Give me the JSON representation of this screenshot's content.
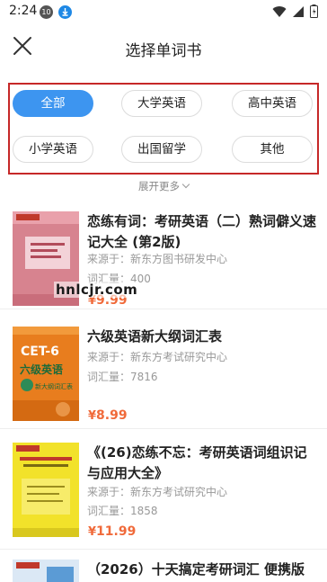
{
  "status_bar": {
    "time": "2:24",
    "notification_badge": "10"
  },
  "header": {
    "title": "选择单词书"
  },
  "filters": {
    "items": [
      "全部",
      "大学英语",
      "高中英语",
      "小学英语",
      "出国留学",
      "其他"
    ],
    "active": "全部",
    "accent": "#3d95f0",
    "highlight_border": "#c62828"
  },
  "expand_label": "展开更多",
  "books": [
    {
      "title": "恋练有词：考研英语（二）熟词僻义速记大全 (第2版)",
      "source_label": "来源于：",
      "source": "新东方图书研发中心",
      "count_label": "词汇量：",
      "count": "400",
      "price_symbol": "¥",
      "price": "9.99",
      "cover_text": "考研英语(二)熟词僻义速记大全"
    },
    {
      "title": "六级英语新大纲词汇表",
      "source_label": "来源于：",
      "source": "新东方考试研究中心",
      "count_label": "词汇量：",
      "count": "7816",
      "price_symbol": "¥",
      "price": "8.99",
      "cover_text": "六级英语",
      "cover_badge": "CET-6",
      "cover_sub": "新大纲词汇表"
    },
    {
      "title": "《(26)恋练不忘：考研英语词组识记与应用大全》",
      "source_label": "来源于：",
      "source": "新东方考试研究中心",
      "count_label": "词汇量：",
      "count": "1858",
      "price_symbol": "¥",
      "price": "11.99",
      "cover_text": "考研英语词组"
    },
    {
      "title": "（2026）十天搞定考研词汇 便携版"
    }
  ],
  "watermark": "hnlcjr.com",
  "price_color": "#f06a3a"
}
